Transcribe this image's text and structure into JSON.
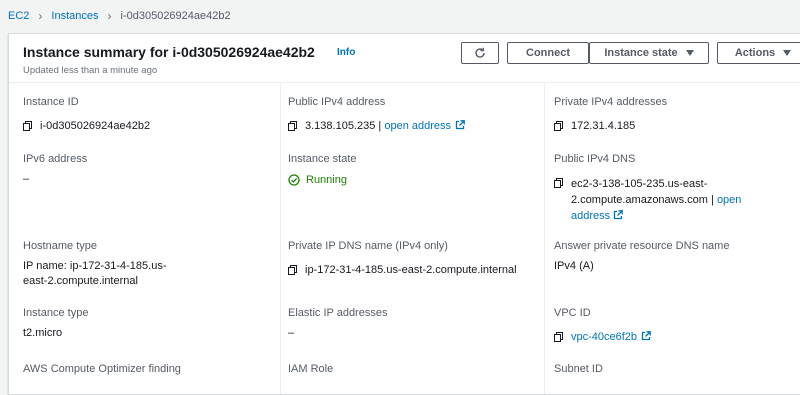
{
  "breadcrumb": {
    "root": "EC2",
    "section": "Instances",
    "current": "i-0d305026924ae42b2"
  },
  "header": {
    "title": "Instance summary for i-0d305026924ae42b2",
    "info": "Info",
    "updated": "Updated less than a minute ago",
    "connect": "Connect",
    "instance_state": "Instance state",
    "actions": "Actions"
  },
  "fields": {
    "instance_id": {
      "label": "Instance ID",
      "value": "i-0d305026924ae42b2"
    },
    "public_ipv4": {
      "label": "Public IPv4 address",
      "value": "3.138.105.235",
      "sep": " | ",
      "link": "open address"
    },
    "private_ipv4": {
      "label": "Private IPv4 addresses",
      "value": "172.31.4.185"
    },
    "ipv6": {
      "label": "IPv6 address",
      "value": "–"
    },
    "instance_state": {
      "label": "Instance state",
      "value": "Running"
    },
    "public_dns": {
      "label": "Public IPv4 DNS",
      "value": "ec2-3-138-105-235.us-east-2.compute.amazonaws.com",
      "sep": " | ",
      "link": "open address"
    },
    "hostname_type": {
      "label": "Hostname type",
      "value": "IP name: ip-172-31-4-185.us-east-2.compute.internal"
    },
    "private_dns": {
      "label": "Private IP DNS name (IPv4 only)",
      "value": "ip-172-31-4-185.us-east-2.compute.internal"
    },
    "answer_dns": {
      "label": "Answer private resource DNS name",
      "value": "IPv4 (A)"
    },
    "instance_type": {
      "label": "Instance type",
      "value": "t2.micro"
    },
    "elastic_ip": {
      "label": "Elastic IP addresses",
      "value": "–"
    },
    "vpc_id": {
      "label": "VPC ID",
      "value": "vpc-40ce6f2b"
    },
    "optimizer": {
      "label": "AWS Compute Optimizer finding"
    },
    "iam_role": {
      "label": "IAM Role"
    },
    "subnet_id": {
      "label": "Subnet ID"
    }
  },
  "colors": {
    "link": "#0073bb",
    "success": "#1d8102",
    "border": "#eaeded"
  }
}
